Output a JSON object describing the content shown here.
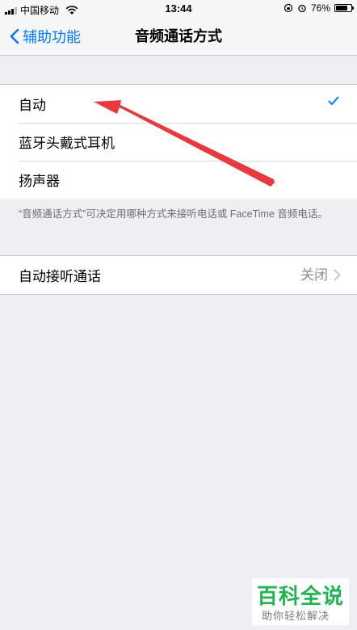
{
  "status_bar": {
    "carrier": "中国移动",
    "time": "13:44",
    "battery": "76%",
    "battery_level": 0.76
  },
  "nav": {
    "back_label": "辅助功能",
    "title": "音频通话方式"
  },
  "options": [
    {
      "label": "自动",
      "selected": true
    },
    {
      "label": "蓝牙头戴式耳机",
      "selected": false
    },
    {
      "label": "扬声器",
      "selected": false
    }
  ],
  "footnote": "“音频通话方式”可决定用哪种方式来接听电话或 FaceTime 音频电话。",
  "auto_answer": {
    "label": "自动接听通话",
    "value": "关闭"
  },
  "watermark": {
    "title": "百科全说",
    "subtitle": "助你轻松解决"
  },
  "colors": {
    "accent": "#007aff",
    "annotation_arrow": "#e8393f",
    "watermark": "#18b04a"
  }
}
